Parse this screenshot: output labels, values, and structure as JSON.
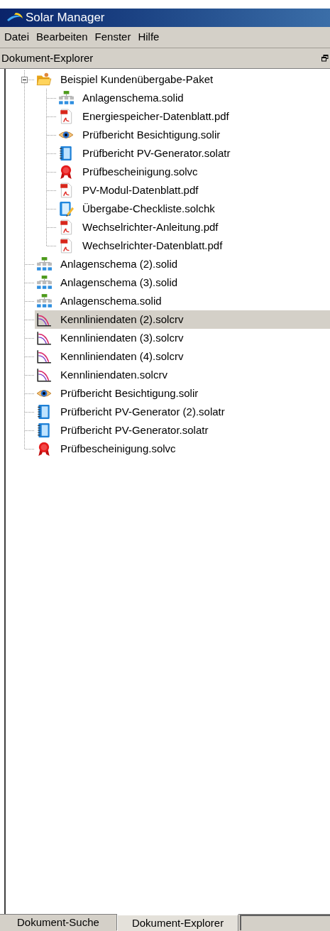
{
  "window": {
    "title": "Solar Manager"
  },
  "menu": [
    "Datei",
    "Bearbeiten",
    "Fenster",
    "Hilfe"
  ],
  "panel": {
    "title": "Dokument-Explorer"
  },
  "tree": [
    {
      "label": "Beispiel Kundenübergabe-Paket",
      "kind": "folder",
      "expanded": true,
      "selected": false,
      "children": [
        {
          "label": "Anlagenschema.solid",
          "kind": "schema",
          "selected": false
        },
        {
          "label": "Energiespeicher-Datenblatt.pdf",
          "kind": "pdf",
          "selected": false
        },
        {
          "label": "Prüfbericht Besichtigung.solir",
          "kind": "eye",
          "selected": false
        },
        {
          "label": "Prüfbericht PV-Generator.solatr",
          "kind": "report",
          "selected": false
        },
        {
          "label": "Prüfbescheinigung.solvc",
          "kind": "seal",
          "selected": false
        },
        {
          "label": "PV-Modul-Datenblatt.pdf",
          "kind": "pdf",
          "selected": false
        },
        {
          "label": "Übergabe-Checkliste.solchk",
          "kind": "checklist",
          "selected": false
        },
        {
          "label": "Wechselrichter-Anleitung.pdf",
          "kind": "pdf",
          "selected": false
        },
        {
          "label": "Wechselrichter-Datenblatt.pdf",
          "kind": "pdf",
          "selected": false
        }
      ]
    },
    {
      "label": "Anlagenschema (2).solid",
      "kind": "schema",
      "selected": false
    },
    {
      "label": "Anlagenschema (3).solid",
      "kind": "schema",
      "selected": false
    },
    {
      "label": "Anlagenschema.solid",
      "kind": "schema",
      "selected": false
    },
    {
      "label": "Kennliniendaten (2).solcrv",
      "kind": "curve",
      "selected": true
    },
    {
      "label": "Kennliniendaten (3).solcrv",
      "kind": "curve",
      "selected": false
    },
    {
      "label": "Kennliniendaten (4).solcrv",
      "kind": "curve",
      "selected": false
    },
    {
      "label": "Kennliniendaten.solcrv",
      "kind": "curve",
      "selected": false
    },
    {
      "label": "Prüfbericht Besichtigung.solir",
      "kind": "eye",
      "selected": false
    },
    {
      "label": "Prüfbericht PV-Generator (2).solatr",
      "kind": "report",
      "selected": false
    },
    {
      "label": "Prüfbericht PV-Generator.solatr",
      "kind": "report",
      "selected": false
    },
    {
      "label": "Prüfbescheinigung.solvc",
      "kind": "seal",
      "selected": false
    }
  ],
  "tabs": [
    {
      "label": "Dokument-Suche",
      "selected": false
    },
    {
      "label": "Dokument-Explorer",
      "selected": true
    }
  ]
}
